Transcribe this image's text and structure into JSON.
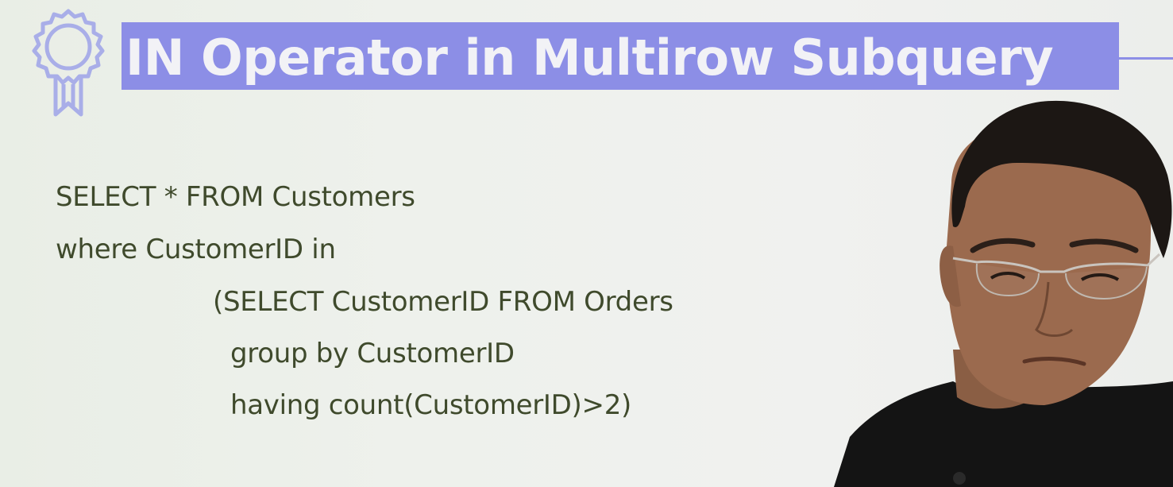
{
  "slide": {
    "title": "IN Operator in Multirow Subquery",
    "code_lines": [
      "SELECT * FROM Customers",
      "where CustomerID in",
      "(SELECT CustomerID FROM Orders",
      "group by CustomerID",
      "having count(CustomerID)>2)"
    ]
  },
  "icons": {
    "badge": "award-ribbon-icon"
  },
  "colors": {
    "title_banner": "#8c8ee6",
    "title_text": "#f2f2f6",
    "code_text": "#3f4a2c",
    "background": "#eef1ec"
  }
}
